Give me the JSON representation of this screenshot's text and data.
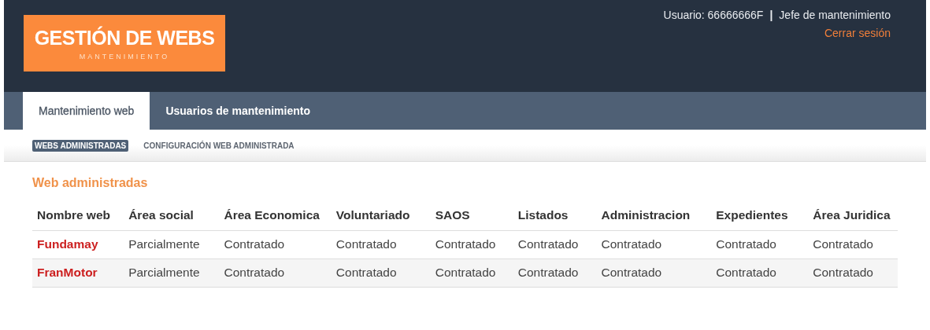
{
  "header": {
    "logo_title": "GESTIÓN DE WEBS",
    "logo_subtitle": "MANTENIMIENTO",
    "user_label": "Usuario: 66666666F",
    "separator": "|",
    "role": "Jefe de mantenimiento",
    "logout": "Cerrar sesión"
  },
  "tabs": [
    {
      "label": "Mantenimiento web",
      "selected": true
    },
    {
      "label": "Usuarios de mantenimiento",
      "selected": false
    }
  ],
  "subnav": [
    {
      "label": "WEBS ADMINISTRADAS",
      "selected": true
    },
    {
      "label": "CONFIGURACIÓN WEB ADMINISTRADA",
      "selected": false
    }
  ],
  "section_title": "Web administradas",
  "table": {
    "columns": [
      "Nombre web",
      "Área social",
      "Área Economica",
      "Voluntariado",
      "SAOS",
      "Listados",
      "Administracion",
      "Expedientes",
      "Área Juridica"
    ],
    "rows": [
      [
        "Fundamay",
        "Parcialmente",
        "Contratado",
        "Contratado",
        "Contratado",
        "Contratado",
        "Contratado",
        "Contratado",
        "Contratado"
      ],
      [
        "FranMotor",
        "Parcialmente",
        "Contratado",
        "Contratado",
        "Contratado",
        "Contratado",
        "Contratado",
        "Contratado",
        "Contratado"
      ]
    ]
  }
}
